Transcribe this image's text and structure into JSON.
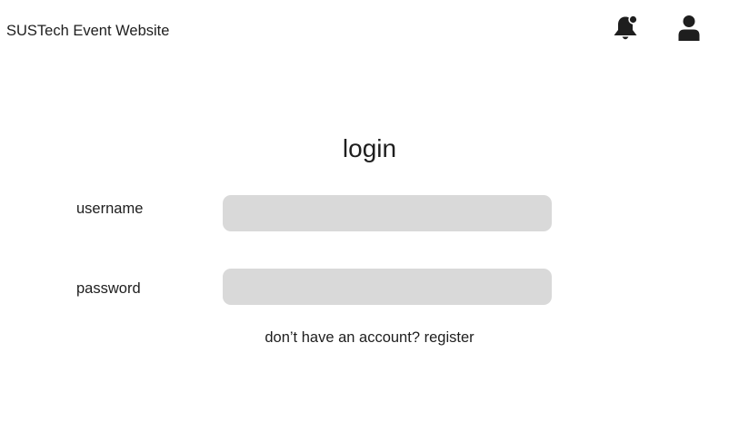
{
  "header": {
    "title": "SUSTech Event Website",
    "notification_icon": "bell-icon",
    "profile_icon": "user-icon"
  },
  "login": {
    "title": "login",
    "username_label": "username",
    "username_value": "",
    "password_label": "password",
    "password_value": "",
    "prompt_text": "don’t have an account?",
    "register_link": "register"
  },
  "colors": {
    "text": "#1e1e1e",
    "input_background": "#d9d9d9",
    "page_background": "#ffffff"
  }
}
